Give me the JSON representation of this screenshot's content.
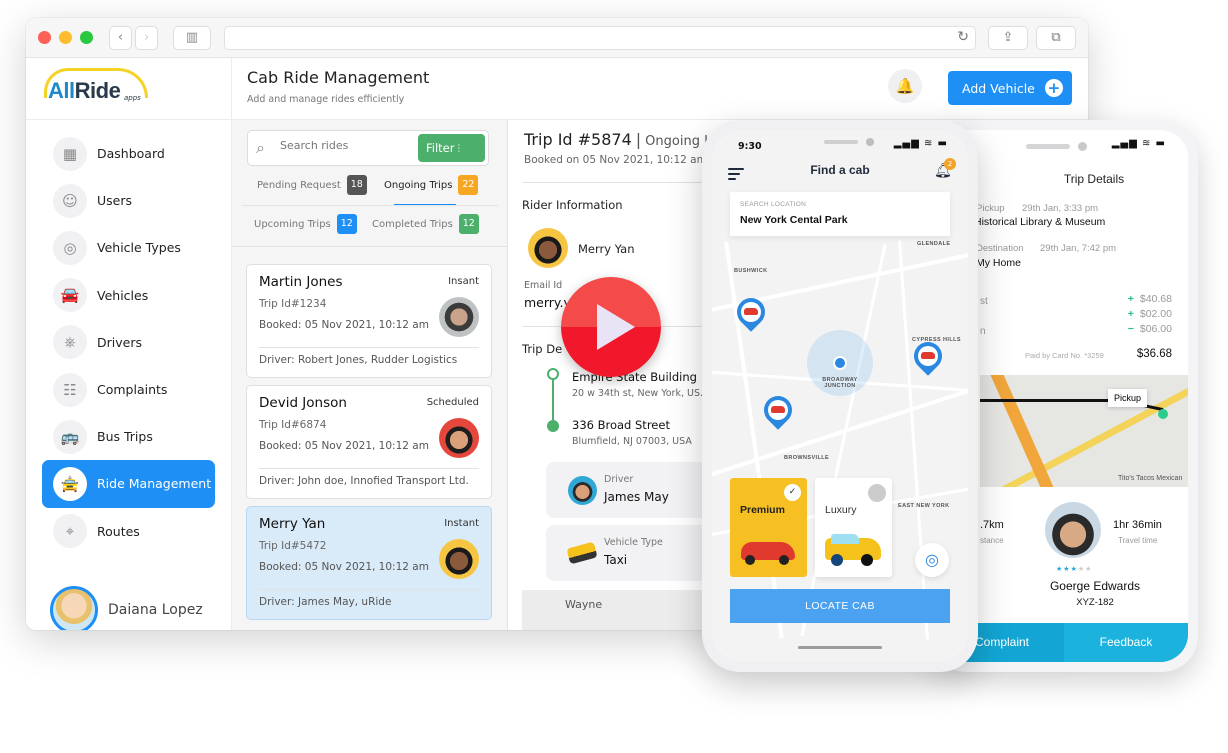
{
  "browser": {
    "nav_back": "‹",
    "nav_forward": "›",
    "sidebar_toggle": "▥",
    "reload": "↻",
    "share": "⇪",
    "tabs": "⧉"
  },
  "app": {
    "logo": {
      "brand_a": "All",
      "brand_b": "Ride",
      "suffix": "apps"
    },
    "header": {
      "title": "Cab Ride Management",
      "subtitle": "Add and manage rides efficiently",
      "bell": "🔔",
      "add_vehicle_label": "Add Vehicle",
      "add_icon": "+"
    },
    "sidebar": {
      "items": [
        {
          "label": "Dashboard",
          "icon": "▦"
        },
        {
          "label": "Users",
          "icon": "☺"
        },
        {
          "label": "Vehicle Types",
          "icon": "◎"
        },
        {
          "label": "Vehicles",
          "icon": "🚘"
        },
        {
          "label": "Drivers",
          "icon": "⎈"
        },
        {
          "label": "Complaints",
          "icon": "☷"
        },
        {
          "label": "Bus Trips",
          "icon": "🚌"
        },
        {
          "label": "Ride Management",
          "icon": "🚖",
          "active": true
        },
        {
          "label": "Routes",
          "icon": "⌖"
        }
      ],
      "user_name": "Daiana Lopez"
    },
    "rides": {
      "search_placeholder": "Search rides",
      "filter_label": "Filter",
      "filter_icon": "⫶",
      "tabs": [
        {
          "label": "Pending Request",
          "count": "18",
          "color": "#555555"
        },
        {
          "label": "Ongoing Trips",
          "count": "22",
          "color": "#f5a623",
          "active": true
        },
        {
          "label": "Upcoming Trips",
          "count": "12",
          "color": "#1e8ff4"
        },
        {
          "label": "Completed Trips",
          "count": "12",
          "color": "#4caf6b"
        }
      ],
      "cards": [
        {
          "name": "Martin Jones",
          "type": "Insant",
          "trip": "Trip Id#1234",
          "booked": "Booked: 05 Nov 2021, 10:12 am",
          "driver": "Driver: Robert Jones, Rudder Logistics"
        },
        {
          "name": "Devid Jonson",
          "type": "Scheduled",
          "trip": "Trip Id#6874",
          "booked": "Booked: 05 Nov 2021, 10:12 am",
          "driver": "Driver: John doe, Innofied Transport Ltd."
        },
        {
          "name": "Merry Yan",
          "type": "Instant",
          "trip": "Trip Id#5472",
          "booked": "Booked: 05 Nov 2021, 10:12 am",
          "driver": "Driver: James May, uRide",
          "selected": true
        }
      ]
    },
    "detail": {
      "trip_id": "Trip Id #5874",
      "status": "Ongoing In",
      "booked": "Booked on 05 Nov 2021, 10:12 am",
      "rider_section": "Rider Information",
      "rider_name": "Merry Yan",
      "email_label": "Email Id",
      "email_value": "merry.y          om",
      "trip_section": "Trip De",
      "pickup_name": "Empire State Building",
      "pickup_addr": "20 w 34th st, New York, US.",
      "drop_name": "336 Broad Street",
      "drop_addr": "Blumfield, NJ 07003, USA",
      "driver_label": "Driver",
      "driver_name": "James May",
      "vehicle_label": "Vehicle Type",
      "vehicle_value": "Taxi",
      "map_label": "Wayne"
    }
  },
  "phone_find_cab": {
    "time": "9:30",
    "status_icons": "▂▄▆ ≋ ▬",
    "title": "Find a cab",
    "bell_badge": "2",
    "search_label": "SEARCH LOCATION",
    "search_value": "New York Cental Park",
    "areas": [
      "GLENDALE",
      "BUSHWICK",
      "CYPRESS HILLS",
      "BROADWAY JUNCTION",
      "BROWNSVILLE",
      "EAST NEW YORK"
    ],
    "cab_options": [
      {
        "label": "Premium",
        "selected": true
      },
      {
        "label": "Luxury",
        "selected": false
      }
    ],
    "check": "✓",
    "gps_icon": "◎",
    "locate_label": "LOCATE CAB"
  },
  "phone_trip_details": {
    "status_icons": "▂▄▆ ≋ ▬",
    "title": "Trip Details",
    "pickup_label": "Pickup",
    "pickup_time": "29th Jan, 3:33 pm",
    "pickup_place": "Historical Library & Museum",
    "destination_label": "Destination",
    "destination_time": "29th Jan, 7:42 pm",
    "destination_place": "My Home",
    "fare_labels": [
      "st",
      "",
      "n"
    ],
    "fares": [
      {
        "sign": "+",
        "amount": "$40.68"
      },
      {
        "sign": "+",
        "amount": "$02.00"
      },
      {
        "sign": "−",
        "amount": "$06.00"
      }
    ],
    "paid_by": "Paid by Card No. *3259",
    "total": "$36.68",
    "map_pickup": "Pickup",
    "map_poi": "Tito's Tacos Mexican",
    "distance_value": ".7km",
    "distance_label": "stance",
    "time_value": "1hr 36min",
    "time_label": "Travel time",
    "rating": 3,
    "rating_max": 5,
    "driver_name": "Goerge Edwards",
    "plate": "XYZ-182",
    "complaint_label": "Complaint",
    "feedback_label": "Feedback"
  }
}
